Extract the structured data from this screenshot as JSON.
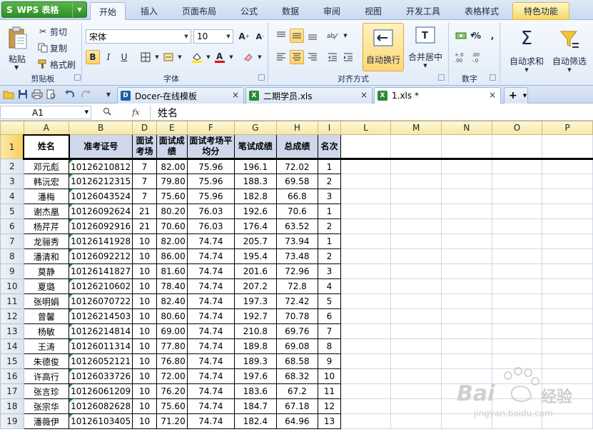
{
  "app": {
    "title": "WPS 表格"
  },
  "menu": [
    {
      "label": "开始"
    },
    {
      "label": "插入"
    },
    {
      "label": "页面布局"
    },
    {
      "label": "公式"
    },
    {
      "label": "数据"
    },
    {
      "label": "审阅"
    },
    {
      "label": "视图"
    },
    {
      "label": "开发工具"
    },
    {
      "label": "表格样式"
    },
    {
      "label": "特色功能"
    }
  ],
  "ribbon": {
    "clipboard": {
      "paste": "粘贴",
      "cut": "剪切",
      "copy": "复制",
      "format_painter": "格式刷",
      "group": "剪贴板"
    },
    "font": {
      "name": "宋体",
      "size": "10",
      "bold": "B",
      "italic": "I",
      "underline": "U",
      "group": "字体"
    },
    "align": {
      "wrap": "自动换行",
      "merge": "合并居中",
      "group": "对齐方式"
    },
    "number": {
      "group": "数字",
      "percent": "%",
      "comma": ","
    },
    "autosum": "自动求和",
    "autofilter": "自动筛选"
  },
  "tabs": [
    {
      "label": "Docer-在线模板",
      "active": false
    },
    {
      "label": "二期学员.xls",
      "active": false
    },
    {
      "label": "1.xls *",
      "active": true
    }
  ],
  "formula_bar": {
    "cell": "A1",
    "fx": "fx",
    "content": "姓名"
  },
  "columns": [
    "A",
    "B",
    "D",
    "E",
    "F",
    "G",
    "H",
    "I",
    "L",
    "M",
    "N",
    "O",
    "P"
  ],
  "header_row": {
    "num": "1",
    "cells": [
      "姓名",
      "准考证号",
      "面试考场",
      "面试成绩",
      "面试考场平均分",
      "笔试成绩",
      "总成绩",
      "名次"
    ]
  },
  "rows": [
    {
      "num": "2",
      "cells": [
        "邓元彪",
        "10126210812",
        "7",
        "82.00",
        "75.96",
        "196.1",
        "72.02",
        "1"
      ]
    },
    {
      "num": "3",
      "cells": [
        "韩沅宏",
        "10126212315",
        "7",
        "79.80",
        "75.96",
        "188.3",
        "69.58",
        "2"
      ]
    },
    {
      "num": "4",
      "cells": [
        "潘梅",
        "10126043524",
        "7",
        "75.60",
        "75.96",
        "182.8",
        "66.8",
        "3"
      ]
    },
    {
      "num": "5",
      "cells": [
        "谢杰凰",
        "10126092624",
        "21",
        "80.20",
        "76.03",
        "192.6",
        "70.6",
        "1"
      ]
    },
    {
      "num": "6",
      "cells": [
        "杨芹芹",
        "10126092916",
        "21",
        "70.60",
        "76.03",
        "176.4",
        "63.52",
        "2"
      ]
    },
    {
      "num": "7",
      "cells": [
        "龙骊秀",
        "10126141928",
        "10",
        "82.00",
        "74.74",
        "205.7",
        "73.94",
        "1"
      ]
    },
    {
      "num": "8",
      "cells": [
        "潘清和",
        "10126092212",
        "10",
        "86.00",
        "74.74",
        "195.4",
        "73.48",
        "2"
      ]
    },
    {
      "num": "9",
      "cells": [
        "莫静",
        "10126141827",
        "10",
        "81.60",
        "74.74",
        "201.6",
        "72.96",
        "3"
      ]
    },
    {
      "num": "10",
      "cells": [
        "夏璐",
        "10126210602",
        "10",
        "78.40",
        "74.74",
        "207.2",
        "72.8",
        "4"
      ]
    },
    {
      "num": "11",
      "cells": [
        "张明娟",
        "10126070722",
        "10",
        "82.40",
        "74.74",
        "197.3",
        "72.42",
        "5"
      ]
    },
    {
      "num": "12",
      "cells": [
        "曾馨",
        "10126214503",
        "10",
        "80.60",
        "74.74",
        "192.7",
        "70.78",
        "6"
      ]
    },
    {
      "num": "13",
      "cells": [
        "杨敏",
        "10126214814",
        "10",
        "69.00",
        "74.74",
        "210.8",
        "69.76",
        "7"
      ]
    },
    {
      "num": "14",
      "cells": [
        "王涛",
        "10126011314",
        "10",
        "77.80",
        "74.74",
        "189.8",
        "69.08",
        "8"
      ]
    },
    {
      "num": "15",
      "cells": [
        "朱德俊",
        "10126052121",
        "10",
        "76.80",
        "74.74",
        "189.3",
        "68.58",
        "9"
      ]
    },
    {
      "num": "16",
      "cells": [
        "许高行",
        "10126033726",
        "10",
        "72.00",
        "74.74",
        "197.6",
        "68.32",
        "10"
      ]
    },
    {
      "num": "17",
      "cells": [
        "张言珍",
        "10126061209",
        "10",
        "76.20",
        "74.74",
        "183.6",
        "67.2",
        "11"
      ]
    },
    {
      "num": "18",
      "cells": [
        "张宗华",
        "10126082628",
        "10",
        "75.60",
        "74.74",
        "184.7",
        "67.18",
        "12"
      ]
    },
    {
      "num": "19",
      "cells": [
        "潘薇伊",
        "10126103405",
        "10",
        "71.20",
        "74.74",
        "182.4",
        "64.96",
        "13"
      ]
    }
  ],
  "watermark": {
    "brand": "Bai",
    "brand2": "经验",
    "url": "jingyan.baidu.com"
  }
}
